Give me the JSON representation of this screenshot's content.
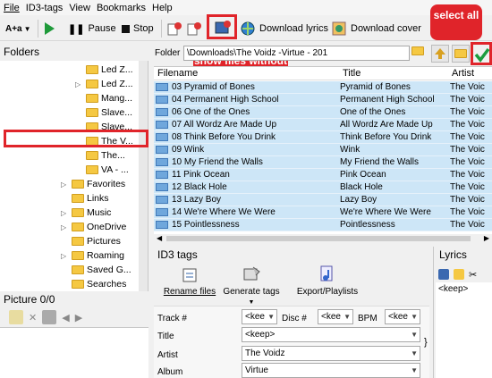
{
  "menu": [
    "File",
    "ID3-tags",
    "View",
    "Bookmarks",
    "Help"
  ],
  "toolbar": {
    "encoding": "A+a",
    "pause": "Pause",
    "stop": "Stop",
    "download_lyrics": "Download lyrics",
    "download_cover": "Download cover"
  },
  "callouts": {
    "show_files": "show files without covers",
    "select_all": "select all"
  },
  "folders": {
    "title": "Folders",
    "items": [
      {
        "label": "Led Z...",
        "indent": 1,
        "arrow": false
      },
      {
        "label": "Led Z...",
        "indent": 1,
        "arrow": true
      },
      {
        "label": "Mang...",
        "indent": 1,
        "arrow": false
      },
      {
        "label": "Slave...",
        "indent": 1,
        "arrow": false
      },
      {
        "label": "Slave...",
        "indent": 1,
        "arrow": false
      },
      {
        "label": "The V...",
        "indent": 1,
        "arrow": false
      },
      {
        "label": "The...",
        "indent": 1,
        "arrow": false
      },
      {
        "label": "VA - ...",
        "indent": 1,
        "arrow": false
      },
      {
        "label": "Favorites",
        "indent": 0,
        "arrow": true
      },
      {
        "label": "Links",
        "indent": 0,
        "arrow": false
      },
      {
        "label": "Music",
        "indent": 0,
        "arrow": true
      },
      {
        "label": "OneDrive",
        "indent": 0,
        "arrow": true
      },
      {
        "label": "Pictures",
        "indent": 0,
        "arrow": false
      },
      {
        "label": "Roaming",
        "indent": 0,
        "arrow": true
      },
      {
        "label": "Saved G...",
        "indent": 0,
        "arrow": false
      },
      {
        "label": "Searches",
        "indent": 0,
        "arrow": false
      }
    ]
  },
  "folder_bar": {
    "label": "Folder",
    "path": "\\Downloads\\The Voidz -Virtue - 201"
  },
  "filelist": {
    "columns": [
      "Filename",
      "Title",
      "Artist"
    ],
    "rows": [
      {
        "file": "03 Pyramid of Bones",
        "title": "Pyramid of Bones",
        "artist": "The Voic"
      },
      {
        "file": "04 Permanent High School",
        "title": "Permanent High School",
        "artist": "The Voic"
      },
      {
        "file": "06 One of the Ones",
        "title": "One of the Ones",
        "artist": "The Voic"
      },
      {
        "file": "07 All Wordz Are Made Up",
        "title": "All Wordz Are Made Up",
        "artist": "The Voic"
      },
      {
        "file": "08 Think Before You Drink",
        "title": "Think Before You Drink",
        "artist": "The Voic"
      },
      {
        "file": "09 Wink",
        "title": "Wink",
        "artist": "The Voic"
      },
      {
        "file": "10 My Friend the Walls",
        "title": "My Friend the Walls",
        "artist": "The Voic"
      },
      {
        "file": "11 Pink Ocean",
        "title": "Pink Ocean",
        "artist": "The Voic"
      },
      {
        "file": "12 Black Hole",
        "title": "Black Hole",
        "artist": "The Voic"
      },
      {
        "file": "13 Lazy Boy",
        "title": "Lazy Boy",
        "artist": "The Voic"
      },
      {
        "file": "14 We're Where We Were",
        "title": "We're Where We Were",
        "artist": "The Voic"
      },
      {
        "file": "15 Pointlessness",
        "title": "Pointlessness",
        "artist": "The Voic"
      }
    ]
  },
  "picture": {
    "title": "Picture 0/0"
  },
  "id3": {
    "title": "ID3 tags",
    "rename_files": "Rename files",
    "generate_tags": "Generate tags",
    "export_playlists": "Export/Playlists",
    "track_label": "Track #",
    "track_value": "<kee",
    "disc_label": "Disc #",
    "disc_value": "<kee",
    "bpm_label": "BPM",
    "bpm_value": "<kee",
    "title_label": "Title",
    "title_value": "<keep>",
    "artist_label": "Artist",
    "artist_value": "The Voidz",
    "album_label": "Album",
    "album_value": "Virtue"
  },
  "lyrics": {
    "title": "Lyrics",
    "value": "<keep>"
  },
  "colors": {
    "accent_red": "#e0242a",
    "selection": "#cde6f7"
  }
}
